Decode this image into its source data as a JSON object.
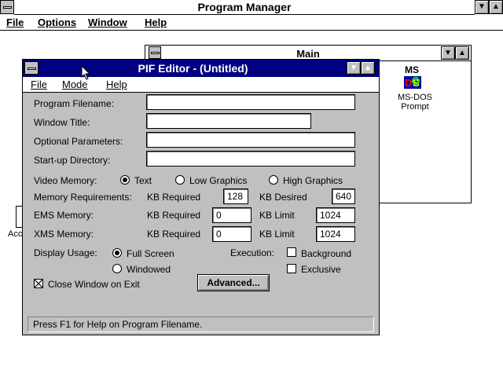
{
  "program_manager": {
    "title": "Program Manager",
    "menu": [
      "File",
      "Options",
      "Window",
      "Help"
    ]
  },
  "main_group": {
    "title": "Main",
    "icon_label_line1": "MS-DOS",
    "icon_label_line2": "Prompt",
    "partial_icon_label": "Acc"
  },
  "pif_editor": {
    "title": "PIF Editor - (Untitled)",
    "menu": [
      "File",
      "Mode",
      "Help"
    ],
    "fields": {
      "program_filename": {
        "label": "Program Filename:",
        "value": ""
      },
      "window_title": {
        "label": "Window Title:",
        "value": ""
      },
      "optional_parameters": {
        "label": "Optional Parameters:",
        "value": ""
      },
      "startup_directory": {
        "label": "Start-up Directory:",
        "value": ""
      }
    },
    "video_memory": {
      "label": "Video Memory:",
      "options": [
        "Text",
        "Low Graphics",
        "High Graphics"
      ],
      "selected": "Text"
    },
    "memory_requirements": {
      "label": "Memory Requirements:",
      "kb_required_label": "KB Required",
      "kb_required": "128",
      "kb_desired_label": "KB Desired",
      "kb_desired": "640"
    },
    "ems_memory": {
      "label": "EMS Memory:",
      "kb_required_label": "KB Required",
      "kb_required": "0",
      "kb_limit_label": "KB Limit",
      "kb_limit": "1024"
    },
    "xms_memory": {
      "label": "XMS Memory:",
      "kb_required_label": "KB Required",
      "kb_required": "0",
      "kb_limit_label": "KB Limit",
      "kb_limit": "1024"
    },
    "display_usage": {
      "label": "Display Usage:",
      "options": [
        "Full Screen",
        "Windowed"
      ],
      "selected": "Full Screen"
    },
    "execution": {
      "label": "Execution:",
      "background": {
        "label": "Background",
        "checked": false
      },
      "exclusive": {
        "label": "Exclusive",
        "checked": false
      }
    },
    "close_window_on_exit": {
      "label": "Close Window on Exit",
      "checked": true
    },
    "advanced_button": "Advanced...",
    "status_text": "Press F1 for Help on Program Filename."
  },
  "colors": {
    "title_active": "#000080",
    "face": "#c0c0c0",
    "window": "#ffffff"
  },
  "icons": [
    "system-menu-icon",
    "minimize-arrow-icon",
    "maximize-arrow-icon",
    "msdos-prompt-icon",
    "mouse-pointer-icon"
  ]
}
